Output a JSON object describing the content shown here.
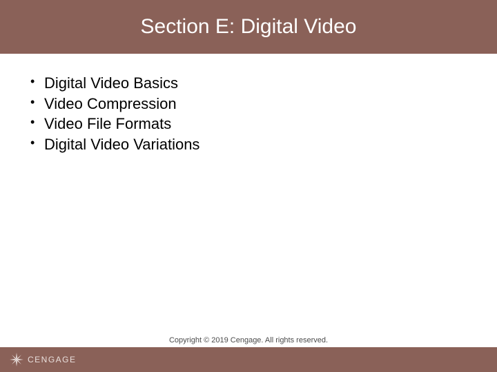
{
  "title": "Section E: Digital Video",
  "bullets": {
    "b0": "Digital Video Basics",
    "b1": "Video Compression",
    "b2": "Video File Formats",
    "b3": "Digital Video Variations"
  },
  "footer": {
    "brand": "CENGAGE",
    "copyright": "Copyright © 2019 Cengage. All rights reserved."
  }
}
